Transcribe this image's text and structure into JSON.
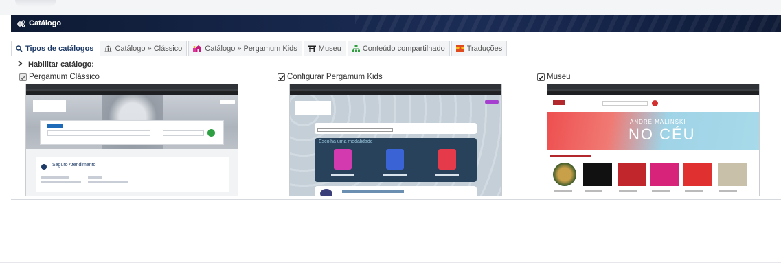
{
  "header": {
    "title": "Catálogo",
    "icon": "cogs-icon"
  },
  "tabs": [
    {
      "label": "Tipos de catálogos",
      "icon": "search-icon",
      "active": true
    },
    {
      "label": "Catálogo » Clássico",
      "icon": "institution-icon",
      "active": false
    },
    {
      "label": "Catálogo » Pergamum Kids",
      "icon": "kids-icon",
      "active": false
    },
    {
      "label": "Museu",
      "icon": "torii-icon",
      "active": false
    },
    {
      "label": "Conteúdo compartilhado",
      "icon": "sitemap-icon",
      "active": false
    },
    {
      "label": "Traduções",
      "icon": "flag-icon",
      "active": false
    }
  ],
  "section": {
    "label": "Habilitar catálogo:"
  },
  "catalogs": [
    {
      "label": "Pergamum Clássico",
      "checked": true,
      "disabled": true
    },
    {
      "label": "Configurar Pergamum Kids",
      "checked": true,
      "disabled": false
    },
    {
      "label": "Museu",
      "checked": true,
      "disabled": false
    }
  ],
  "previews": {
    "classic": {
      "heading": "Seguro Atendimento"
    },
    "kids": {
      "heading": "Escolha uma modalidade"
    },
    "museum": {
      "banner_small": "ANDRÉ MALINSKI",
      "banner_big": "NO CÉU"
    }
  },
  "colors": {
    "header_bg": "#16264a",
    "accent": "#1d3a66",
    "tab_border": "#d6d9de"
  }
}
